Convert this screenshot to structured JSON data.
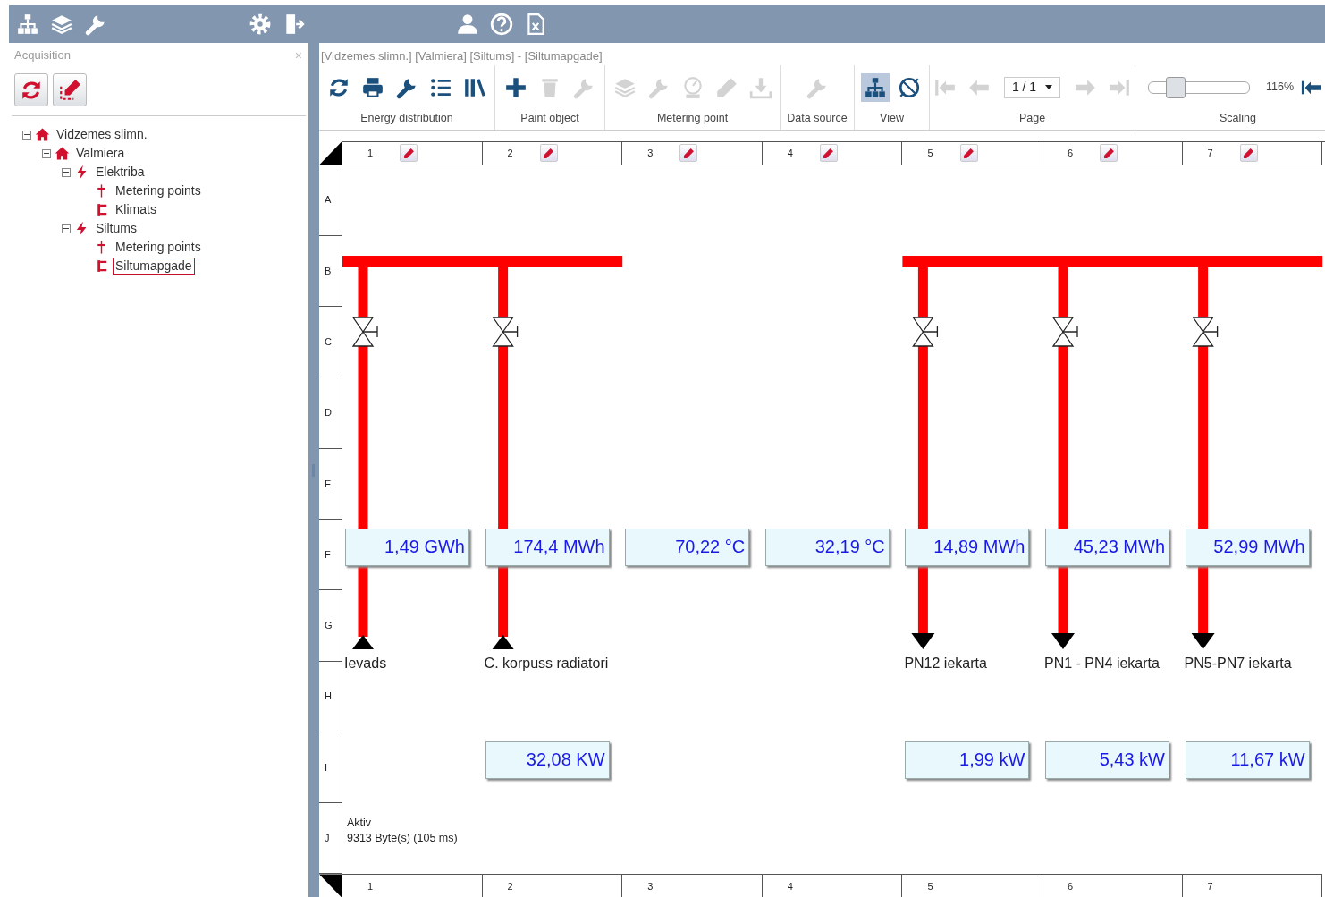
{
  "sidebar": {
    "title": "Acquisition",
    "close": "×",
    "tree": [
      {
        "label": "Vidzemes slimn.",
        "kind": "site",
        "expanded": true,
        "selected": false,
        "children": [
          {
            "label": "Valmiera",
            "kind": "site",
            "expanded": true,
            "selected": false,
            "children": [
              {
                "label": "Elektriba",
                "kind": "medium",
                "expanded": true,
                "selected": false,
                "children": [
                  {
                    "label": "Metering points",
                    "kind": "meters",
                    "selected": false
                  },
                  {
                    "label": "Klimats",
                    "kind": "circuit",
                    "selected": false
                  }
                ]
              },
              {
                "label": "Siltums",
                "kind": "medium",
                "expanded": true,
                "selected": false,
                "children": [
                  {
                    "label": "Metering points",
                    "kind": "meters",
                    "selected": false
                  },
                  {
                    "label": "Siltumapgade",
                    "kind": "circuit",
                    "selected": true
                  }
                ]
              }
            ]
          }
        ]
      }
    ]
  },
  "breadcrumb": "[Vidzemes slimn.] [Valmiera] [Siltums] - [Siltumapgade]",
  "ribbon": {
    "groups": [
      {
        "label": "Energy distribution",
        "tools": [
          {
            "disabled": false
          },
          {
            "disabled": false
          },
          {
            "disabled": false
          },
          {
            "disabled": false
          },
          {
            "disabled": false
          }
        ]
      },
      {
        "label": "Paint object",
        "tools": [
          {
            "disabled": false
          },
          {
            "disabled": true
          },
          {
            "disabled": true
          }
        ]
      },
      {
        "label": "Metering point",
        "tools": [
          {
            "disabled": true
          },
          {
            "disabled": true
          },
          {
            "disabled": true
          },
          {
            "disabled": true
          },
          {
            "disabled": true
          }
        ]
      },
      {
        "label": "Data source",
        "tools": [
          {
            "disabled": true
          }
        ]
      },
      {
        "label": "View",
        "tools": [
          {
            "disabled": false,
            "selected": true
          },
          {
            "disabled": false,
            "selected": false
          }
        ]
      }
    ],
    "page": {
      "label": "Page",
      "value": "1 / 1",
      "tools": [
        {
          "disabled": true
        },
        {
          "disabled": true
        },
        {
          "disabled": true
        },
        {
          "disabled": true
        }
      ]
    },
    "scaling": {
      "label": "Scaling",
      "level": 0.27,
      "reading": "116%"
    }
  },
  "grid": {
    "columns": [
      "1",
      "2",
      "3",
      "4",
      "5",
      "6",
      "7"
    ],
    "rows": [
      "A",
      "B",
      "C",
      "D",
      "E",
      "F",
      "G",
      "H",
      "I",
      "J"
    ],
    "footer_columns": [
      "1",
      "2",
      "3",
      "4",
      "5",
      "6",
      "7"
    ]
  },
  "diagram": {
    "columns": [
      {
        "header_pipe": true,
        "branch": {
          "kind": "inlet",
          "energy": "1,49 GWh",
          "label": "Ievads"
        }
      },
      {
        "header_pipe": true,
        "branch": {
          "kind": "inlet",
          "energy": "174,4 MWh",
          "label": "C. korpuss radiatori",
          "power": "32,08 KW"
        }
      },
      {
        "header_pipe": false,
        "reading": "70,22 °C"
      },
      {
        "header_pipe": false,
        "reading": "32,19 °C"
      },
      {
        "header_pipe": true,
        "branch": {
          "kind": "outlet",
          "energy": "14,89 MWh",
          "label": "PN12 iekarta",
          "power": "1,99 kW"
        }
      },
      {
        "header_pipe": true,
        "branch": {
          "kind": "outlet",
          "energy": "45,23 MWh",
          "label": "PN1 - PN4 iekarta",
          "power": "5,43 kW"
        }
      },
      {
        "header_pipe": true,
        "branch": {
          "kind": "outlet",
          "energy": "52,99 MWh",
          "label": "PN5-PN7 iekarta",
          "power": "11,67 kW"
        }
      }
    ]
  },
  "status": {
    "state": "Aktiv",
    "transfer": "9313 Byte(s) (105 ms)"
  }
}
